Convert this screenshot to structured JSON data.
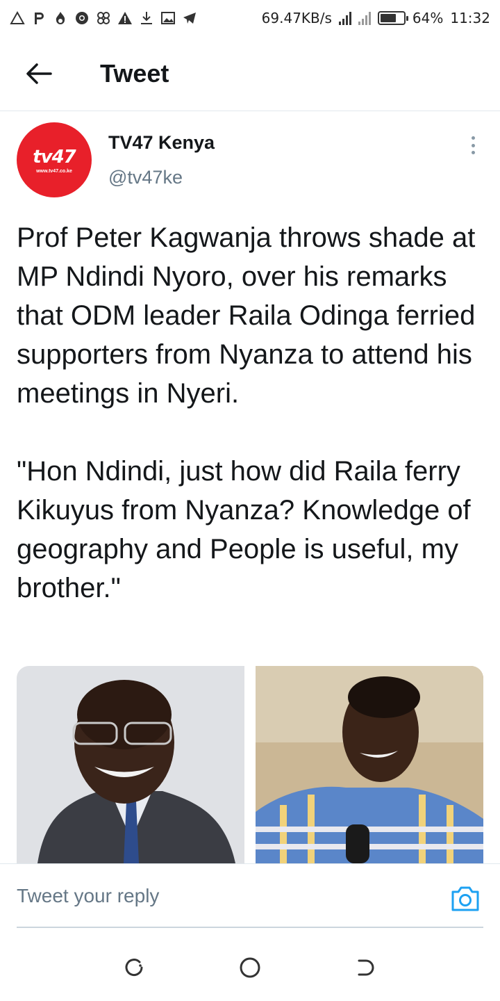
{
  "status_bar": {
    "net_speed": "69.47KB/s",
    "battery": "64%",
    "time": "11:32",
    "icons": [
      "alert-icon",
      "p-icon",
      "fire-icon",
      "chrome-icon",
      "puzzle-icon",
      "warning-icon",
      "download-icon",
      "gallery-icon",
      "telegram-icon"
    ]
  },
  "header": {
    "title": "Tweet"
  },
  "tweet": {
    "author_name": "TV47 Kenya",
    "author_handle": "@tv47ke",
    "avatar": {
      "logo": "tv47",
      "url": "www.tv47.co.ke",
      "color": "#e8202a"
    },
    "text": "Prof Peter Kagwanja throws shade at MP Ndindi Nyoro, over his remarks that ODM leader Raila Odinga ferried supporters from Nyanza to attend his meetings in Nyeri.\n\n\"Hon Ndindi, just how did Raila ferry Kikuyus from Nyanza? Knowledge of geography and People is useful, my brother.\""
  },
  "reply": {
    "placeholder": "Tweet your reply",
    "accent_color": "#1da1f2"
  }
}
